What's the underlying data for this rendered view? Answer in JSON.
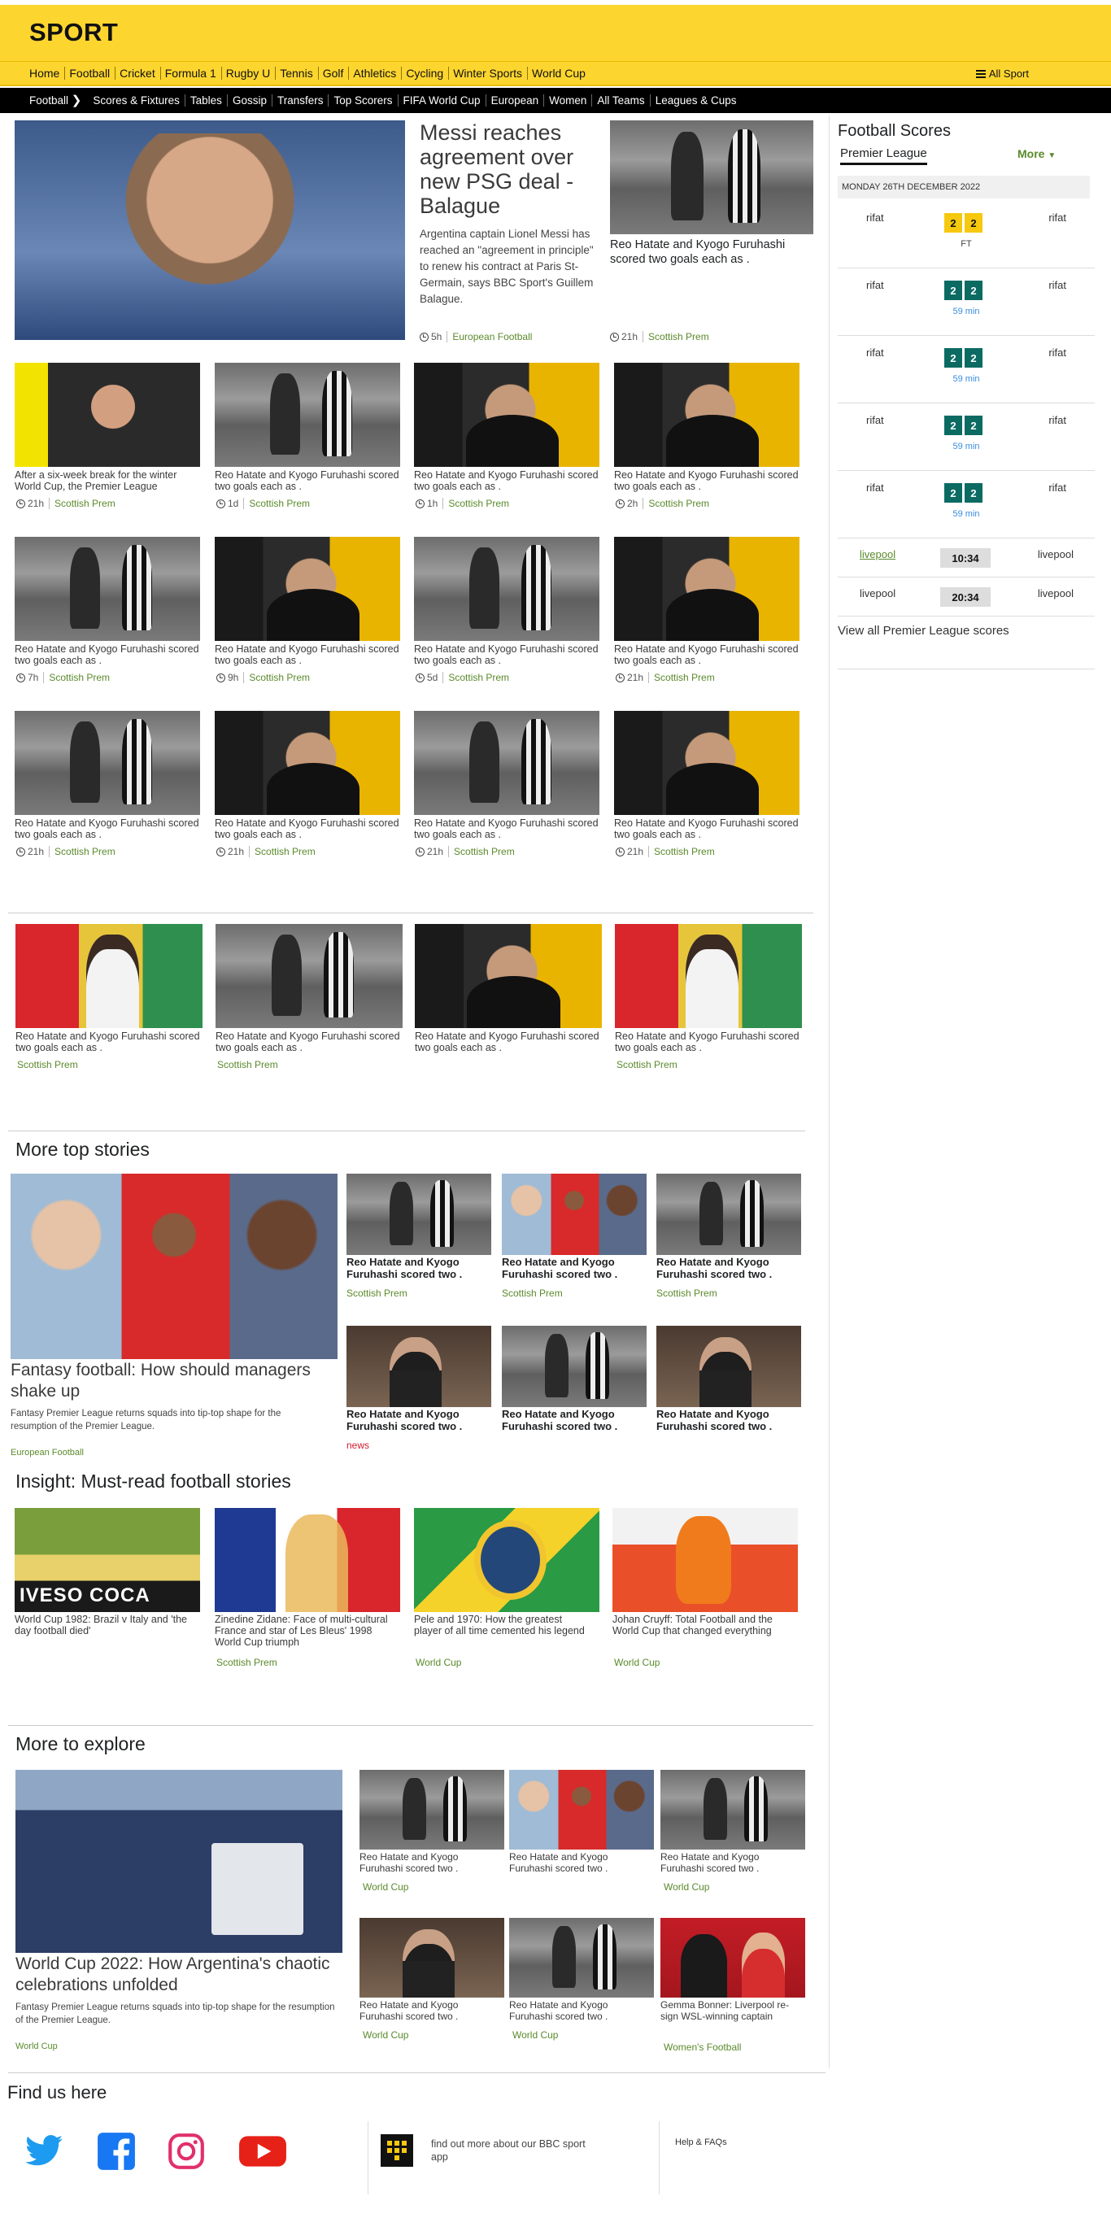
{
  "header": {
    "brand": "SPORT",
    "nav": [
      "Home",
      "Football",
      "Cricket",
      "Formula 1",
      "Rugby U",
      "Tennis",
      "Golf",
      "Athletics",
      "Cycling",
      "Winter Sports",
      "World Cup"
    ],
    "all_sport": "All Sport",
    "subnav": [
      "Football",
      "Scores & Fixtures",
      "Tables",
      "Gossip",
      "Transfers",
      "Top Scorers",
      "FIFA World Cup",
      "European",
      "Women",
      "All Teams",
      "Leagues & Cups"
    ]
  },
  "hero": {
    "title": "Messi reaches agreement over new PSG deal - Balague",
    "summary": "Argentina captain Lionel Messi has reached an \"agreement in principle\" to renew his contract at Paris St-Germain, says BBC Sport's Guillem Balague.",
    "time": "5h",
    "tag": "European Football",
    "side_caption": "Reo Hatate and Kyogo Furuhashi scored two goals each as .",
    "side_time": "21h",
    "side_tag": "Scottish Prem"
  },
  "grid": [
    {
      "caption": "After a six-week break for the winter World Cup, the Premier League",
      "time": "21h",
      "tag": "Scottish Prem"
    },
    {
      "caption": "Reo Hatate and Kyogo Furuhashi scored two goals each as .",
      "time": "1d",
      "tag": "Scottish Prem"
    },
    {
      "caption": "Reo Hatate and Kyogo Furuhashi scored two goals each as .",
      "time": "1h",
      "tag": "Scottish Prem"
    },
    {
      "caption": "Reo Hatate and Kyogo Furuhashi scored two goals each as .",
      "time": "2h",
      "tag": "Scottish Prem"
    },
    {
      "caption": "Reo Hatate and Kyogo Furuhashi scored two goals each as .",
      "time": "7h",
      "tag": "Scottish Prem"
    },
    {
      "caption": "Reo Hatate and Kyogo Furuhashi scored two goals each as .",
      "time": "9h",
      "tag": "Scottish Prem"
    },
    {
      "caption": "Reo Hatate and Kyogo Furuhashi scored two goals each as .",
      "time": "5d",
      "tag": "Scottish Prem"
    },
    {
      "caption": "Reo Hatate and Kyogo Furuhashi scored two goals each as .",
      "time": "21h",
      "tag": "Scottish Prem"
    },
    {
      "caption": "Reo Hatate and Kyogo Furuhashi scored two goals each as .",
      "time": "21h",
      "tag": "Scottish Prem"
    },
    {
      "caption": "Reo Hatate and Kyogo Furuhashi scored two goals each as .",
      "time": "21h",
      "tag": "Scottish Prem"
    },
    {
      "caption": "Reo Hatate and Kyogo Furuhashi scored two goals each as .",
      "time": "21h",
      "tag": "Scottish Prem"
    },
    {
      "caption": "Reo Hatate and Kyogo Furuhashi scored two goals each as .",
      "time": "21h",
      "tag": "Scottish Prem"
    },
    {
      "caption": "Reo Hatate and Kyogo Furuhashi scored two goals each as .",
      "time": "",
      "tag": "Scottish Prem"
    },
    {
      "caption": "Reo Hatate and Kyogo Furuhashi scored two goals each as .",
      "time": "",
      "tag": "Scottish Prem"
    },
    {
      "caption": "Reo Hatate and Kyogo Furuhashi scored two goals each as .",
      "time": "",
      "tag": ""
    },
    {
      "caption": "Reo Hatate and Kyogo Furuhashi scored two goals each as .",
      "time": "",
      "tag": "Scottish Prem"
    }
  ],
  "more_top": {
    "heading": "More top stories",
    "feature_title": "Fantasy football: How should managers shake up",
    "feature_summary": "Fantasy Premier League returns squads into tip-top shape for the resumption of the Premier League.",
    "feature_tag": "European Football",
    "items": [
      {
        "caption": "Reo Hatate and Kyogo Furuhashi scored two .",
        "tag": "Scottish Prem"
      },
      {
        "caption": "Reo Hatate and Kyogo Furuhashi scored two .",
        "tag": "Scottish Prem"
      },
      {
        "caption": "Reo Hatate and Kyogo Furuhashi scored two .",
        "tag": "Scottish Prem"
      },
      {
        "caption": "Reo Hatate and Kyogo Furuhashi scored two .",
        "tag": "news"
      },
      {
        "caption": "Reo Hatate and Kyogo Furuhashi scored two .",
        "tag": ""
      },
      {
        "caption": "Reo Hatate and Kyogo Furuhashi scored two .",
        "tag": ""
      }
    ]
  },
  "insight": {
    "heading": "Insight: Must-read football stories",
    "items": [
      {
        "caption": "World Cup 1982: Brazil v Italy and 'the day football died'",
        "tag": ""
      },
      {
        "caption": "Zinedine Zidane: Face of multi-cultural France and star of Les Bleus' 1998 World Cup triumph",
        "tag": "Scottish Prem"
      },
      {
        "caption": "Pele and 1970: How the greatest player of all time cemented his legend",
        "tag": "World Cup"
      },
      {
        "caption": "Johan Cruyff: Total Football and the World Cup that changed everything",
        "tag": "World Cup"
      }
    ],
    "wc82_banner": "IVESO COCA"
  },
  "explore": {
    "heading": "More to explore",
    "feature_title": "World Cup 2022: How Argentina's chaotic celebrations unfolded",
    "feature_summary": "Fantasy Premier League returns squads into tip-top shape for the resumption of the Premier League.",
    "feature_tag": "World Cup",
    "items": [
      {
        "caption": "Reo Hatate and Kyogo Furuhashi scored two .",
        "tag": "World Cup"
      },
      {
        "caption": "Reo Hatate and Kyogo Furuhashi scored two .",
        "tag": ""
      },
      {
        "caption": "Reo Hatate and Kyogo Furuhashi scored two .",
        "tag": "World Cup"
      },
      {
        "caption": "Reo Hatate and Kyogo Furuhashi scored two .",
        "tag": "World Cup"
      },
      {
        "caption": "Reo Hatate and Kyogo Furuhashi scored two .",
        "tag": "World Cup"
      },
      {
        "caption": "Gemma Bonner: Liverpool re-sign WSL-winning captain",
        "tag": "Women's Football"
      }
    ]
  },
  "scores": {
    "heading": "Football Scores",
    "tab": "Premier League",
    "more": "More",
    "date": "MONDAY 26TH DECEMBER 2022",
    "matches": [
      {
        "home": "rifat",
        "away": "rifat",
        "h": "2",
        "a": "2",
        "status": "FT",
        "style": "yellow"
      },
      {
        "home": "rifat",
        "away": "rifat",
        "h": "2",
        "a": "2",
        "status": "59 min",
        "style": "teal"
      },
      {
        "home": "rifat",
        "away": "rifat",
        "h": "2",
        "a": "2",
        "status": "59 min",
        "style": "teal"
      },
      {
        "home": "rifat",
        "away": "rifat",
        "h": "2",
        "a": "2",
        "status": "59 min",
        "style": "teal"
      },
      {
        "home": "rifat",
        "away": "rifat",
        "h": "2",
        "a": "2",
        "status": "59 min",
        "style": "teal"
      }
    ],
    "fixtures": [
      {
        "home": "livepool",
        "away": "livepool",
        "kickoff": "10:34"
      },
      {
        "home": "livepool",
        "away": "livepool",
        "kickoff": "20:34"
      }
    ],
    "view_all": "View all Premier League scores"
  },
  "footer": {
    "heading": "Find us here",
    "app_text": "find out more about our BBC sport app",
    "help": "Help & FAQs",
    "socials": [
      "twitter-icon",
      "facebook-icon",
      "instagram-icon",
      "youtube-icon"
    ]
  },
  "colors": {
    "brand_yellow": "#fdd52f",
    "tag_green": "#5a8a2b",
    "score_teal": "#0b6b63",
    "score_yellow": "#f6c90e",
    "news_red": "#d21d2b"
  }
}
